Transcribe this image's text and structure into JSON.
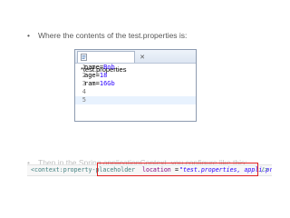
{
  "slide": {
    "bullet": "•",
    "intro_text": "Where the contents of the test.properties is:",
    "lower_text": "Then in the Spring applicationContext, you configure like this:"
  },
  "editor": {
    "tab_label": "*test.properties",
    "close_glyph": "✕",
    "lines": [
      {
        "num": "1",
        "key": "name",
        "eq": "=",
        "value": "Bob"
      },
      {
        "num": "2",
        "key": "age",
        "eq": "=",
        "value": "18"
      },
      {
        "num": "3",
        "key": "ram",
        "eq": "=",
        "value": "16Gb"
      },
      {
        "num": "4",
        "key": "",
        "eq": "",
        "value": ""
      },
      {
        "num": "5",
        "key": "",
        "eq": "",
        "value": ""
      }
    ]
  },
  "xml": {
    "tag_open": "<context:property-placeholder",
    "attr": "location",
    "eq": "=",
    "value": "\"test.properties, appli.properties\"",
    "tag_close": "/>"
  },
  "colors": {
    "value_blue": "#2a00ff",
    "highlight_red": "#e02020",
    "current_line": "#e8f2fe"
  }
}
